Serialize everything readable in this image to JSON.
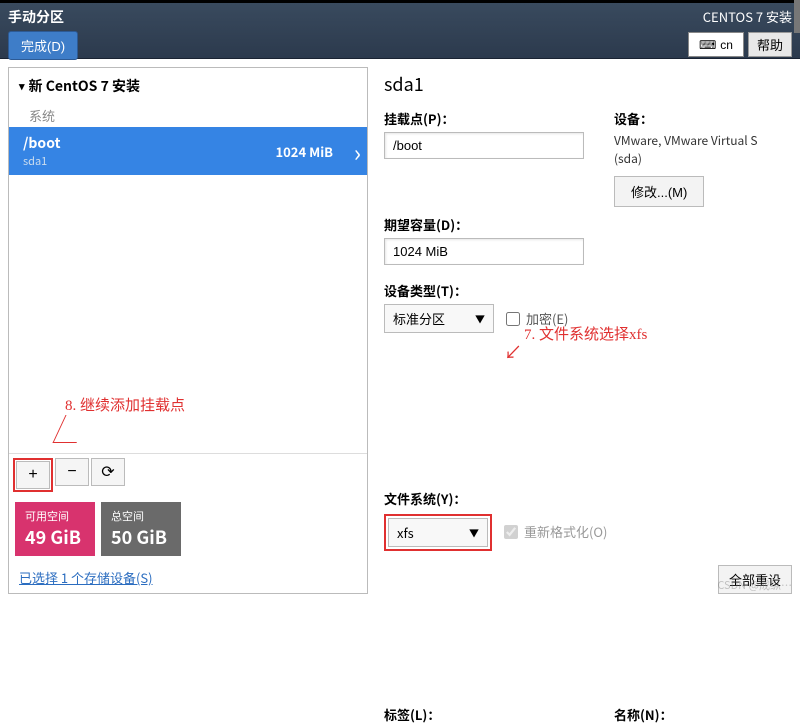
{
  "header": {
    "title": "手动分区",
    "done_btn": "完成(D)",
    "subtitle": "CENTOS 7 安装",
    "lang": "cn",
    "help": "帮助"
  },
  "left": {
    "install_title": "新 CentOS 7 安装",
    "system_label": "系统",
    "partition": {
      "name": "/boot",
      "dev": "sda1",
      "size": "1024 MiB"
    },
    "add_tooltip": "+",
    "remove_tooltip": "−",
    "reload_tooltip": "⟳",
    "avail": {
      "label": "可用空间",
      "value": "49 GiB"
    },
    "total": {
      "label": "总空间",
      "value": "50 GiB"
    },
    "storage_link": "已选择 1 个存储设备(S)"
  },
  "right": {
    "device_title": "sda1",
    "mount_label": "挂载点(P)：",
    "mount_value": "/boot",
    "capacity_label": "期望容量(D)：",
    "capacity_value": "1024 MiB",
    "device_label": "设备：",
    "device_value": "VMware, VMware Virtual S (sda)",
    "modify_btn": "修改...(M)",
    "type_label": "设备类型(T)：",
    "type_value": "标准分区",
    "encrypt_label": "加密(E)",
    "fs_label": "文件系统(Y)：",
    "fs_value": "xfs",
    "reformat_label": "重新格式化(O)",
    "tag_label": "标签(L)：",
    "name_label": "名称(N)：",
    "reset_btn": "全部重设"
  },
  "annotations": {
    "a7": "7. 文件系统选择xfs",
    "a8": "8. 继续添加挂载点"
  },
  "watermark": "CSDN @成纵…"
}
